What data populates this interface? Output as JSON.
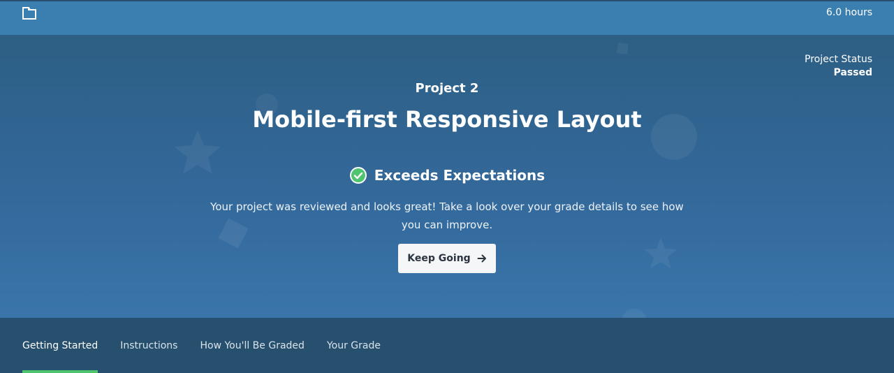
{
  "header": {
    "logo_icon": "notebook-icon",
    "hours": "6.0 hours"
  },
  "hero": {
    "status_label": "Project Status",
    "status_value": "Passed",
    "project_number": "Project 2",
    "project_title": "Mobile-first Responsive Layout",
    "result_icon": "check-circle-icon",
    "result_label": "Exceeds Expectations",
    "summary_line1": "Your project was reviewed and looks great! Take a look over your grade details to see how",
    "summary_line2": "you can improve.",
    "keep_going_label": "Keep Going",
    "keep_going_icon": "arrow-right-icon"
  },
  "tabs": [
    {
      "label": "Getting Started",
      "active": true
    },
    {
      "label": "Instructions",
      "active": false
    },
    {
      "label": "How You'll Be Graded",
      "active": false
    },
    {
      "label": "Your Grade",
      "active": false
    }
  ],
  "colors": {
    "top_bar": "#3b7fb0",
    "hero_bg": "#33689a",
    "tab_bar": "#27506e",
    "active_tab_indicator": "#4fc46f",
    "success_check": "#4fc46f",
    "button_bg": "#f4f6f8"
  }
}
